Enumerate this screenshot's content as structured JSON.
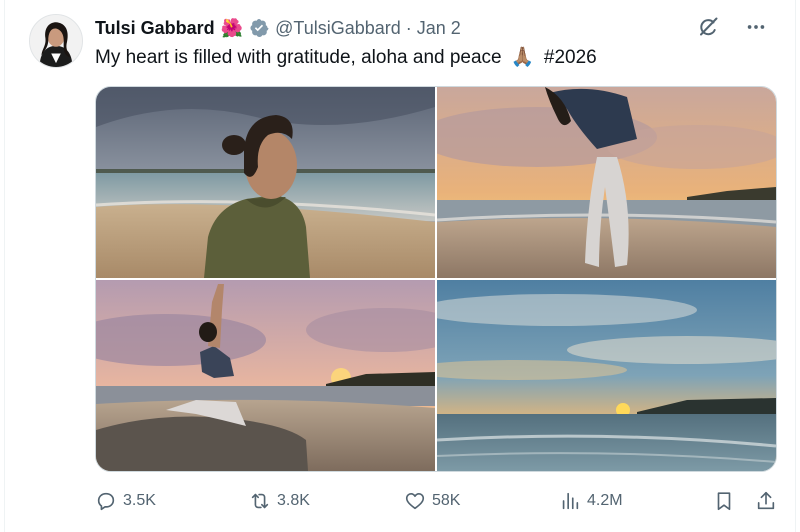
{
  "tweet": {
    "author": {
      "display_name": "Tulsi Gabbard",
      "handle": "@TulsiGabbard",
      "name_emoji": "🌺",
      "verified_icon": "verified-badge-icon"
    },
    "separator": "·",
    "date": "Jan 2",
    "text_before_emoji": "My heart is filled with gratitude, aloha and peace",
    "emoji": "🙏🏽",
    "hashtag": "#2026",
    "media_count": 4
  },
  "top_icons": [
    "grok-icon",
    "more-icon"
  ],
  "actions": {
    "reply": {
      "icon": "reply-icon",
      "count": "3.5K"
    },
    "repost": {
      "icon": "repost-icon",
      "count": "3.8K"
    },
    "like": {
      "icon": "heart-icon",
      "count": "58K"
    },
    "views": {
      "icon": "views-icon",
      "count": "4.2M"
    },
    "bookmark": {
      "icon": "bookmark-icon"
    },
    "share": {
      "icon": "share-icon"
    }
  },
  "colors": {
    "text": "#0f1419",
    "secondary": "#536471",
    "verified": "#829aab",
    "border": "#cfd9de"
  }
}
